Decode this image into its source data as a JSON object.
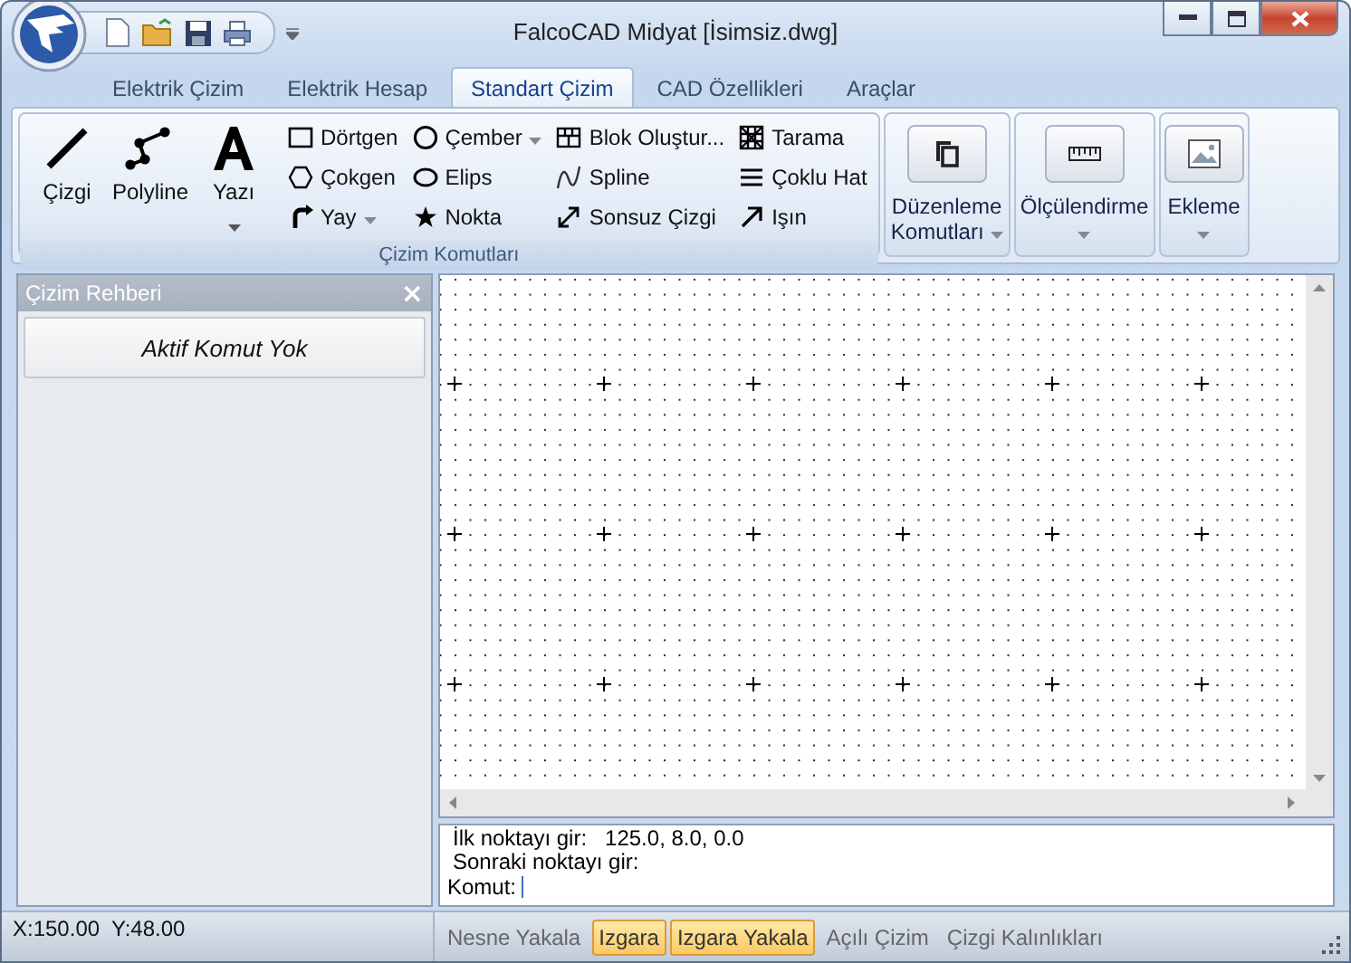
{
  "window": {
    "title": "FalcoCAD Midyat [İsimsiz.dwg]"
  },
  "tabs": [
    {
      "label": "Elektrik Çizim",
      "selected": false
    },
    {
      "label": "Elektrik Hesap",
      "selected": false
    },
    {
      "label": "Standart Çizim",
      "selected": true
    },
    {
      "label": "CAD Özellikleri",
      "selected": false
    },
    {
      "label": "Araçlar",
      "selected": false
    }
  ],
  "ribbon": {
    "draw_group": {
      "title": "Çizim Komutları",
      "large": [
        {
          "label": "Çizgi",
          "dropdown": false
        },
        {
          "label": "Polyline",
          "dropdown": false
        },
        {
          "label": "Yazı",
          "dropdown": true
        }
      ],
      "small": [
        {
          "label": "Dörtgen",
          "dropdown": false
        },
        {
          "label": "Çokgen",
          "dropdown": false
        },
        {
          "label": "Yay",
          "dropdown": true
        },
        {
          "label": "Çember",
          "dropdown": true
        },
        {
          "label": "Elips",
          "dropdown": false
        },
        {
          "label": "Nokta",
          "dropdown": false
        },
        {
          "label": "Blok Oluştur...",
          "dropdown": false
        },
        {
          "label": "Spline",
          "dropdown": false
        },
        {
          "label": "Sonsuz Çizgi",
          "dropdown": false
        },
        {
          "label": "Tarama",
          "dropdown": false
        },
        {
          "label": "Çoklu Hat",
          "dropdown": false
        },
        {
          "label": "Işın",
          "dropdown": false
        }
      ]
    },
    "groups": [
      {
        "label": "Düzenleme Komutları",
        "dropdown": true
      },
      {
        "label": "Ölçülendirme",
        "dropdown": true
      },
      {
        "label": "Ekleme",
        "dropdown": true
      }
    ]
  },
  "side_panel": {
    "title": "Çizim Rehberi",
    "close": "×",
    "button": "Aktif Komut Yok"
  },
  "command_window": {
    "lines": [
      {
        "prompt": "İlk noktayı gir:",
        "value": "125.0, 8.0, 0.0"
      },
      {
        "prompt": "Sonraki noktayı gir:"
      }
    ],
    "input_label": "Komut:"
  },
  "status_bar": {
    "coordinates": "X:150.00  Y:48.00",
    "toggles": [
      {
        "label": "Nesne Yakala",
        "on": false
      },
      {
        "label": "Izgara",
        "on": true
      },
      {
        "label": "Izgara Yakala",
        "on": true
      },
      {
        "label": "Açılı Çizim",
        "on": false
      },
      {
        "label": "Çizgi Kalınlıkları",
        "on": false
      }
    ]
  }
}
